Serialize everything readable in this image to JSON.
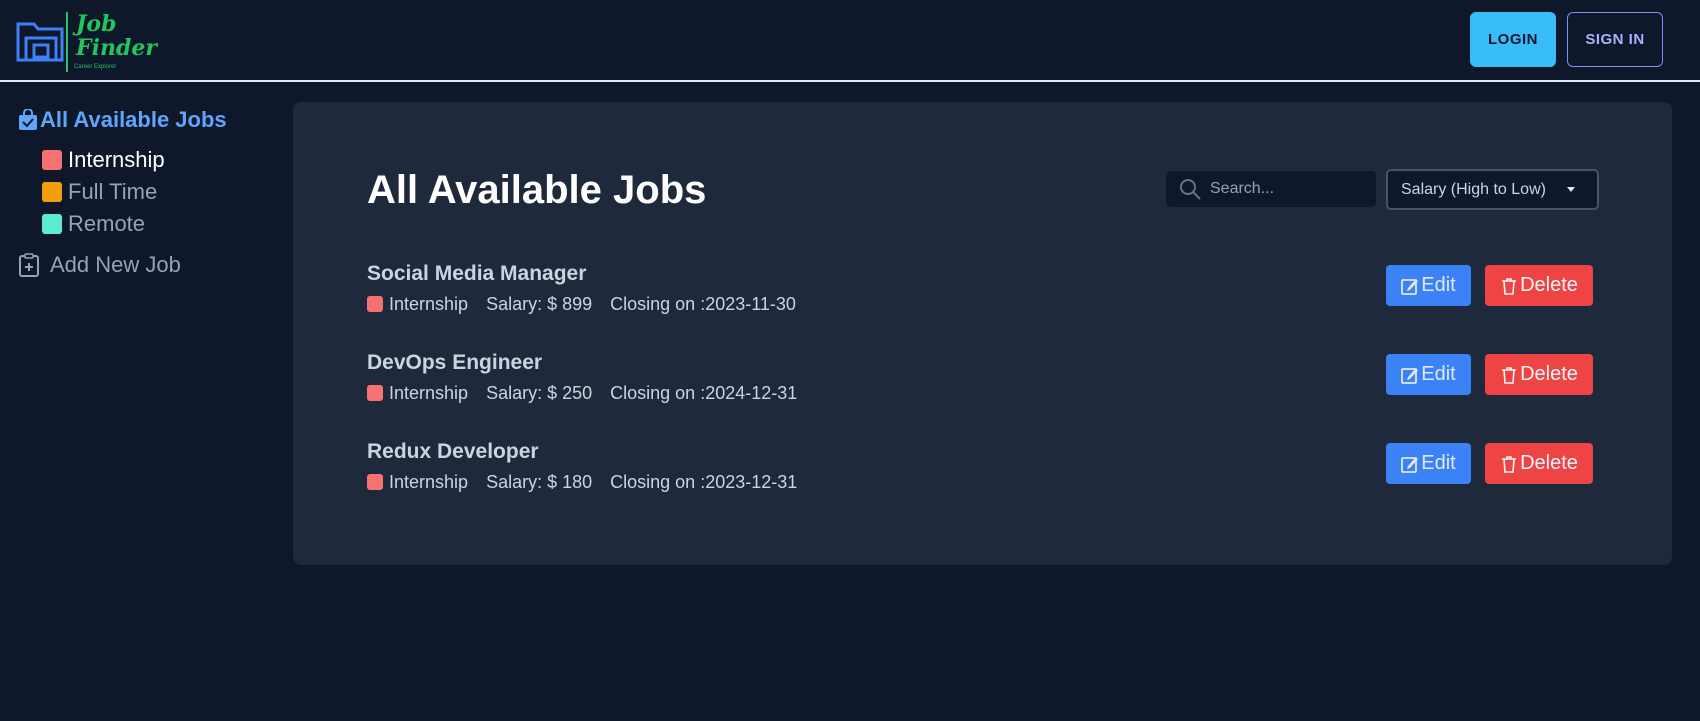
{
  "header": {
    "logo_text": "Job\nFinder",
    "logo_tagline": "Career Explorer",
    "login_label": "LOGIN",
    "signin_label": "SIGN IN"
  },
  "sidebar": {
    "all_jobs_label": "All Available Jobs",
    "filters": [
      {
        "label": "Internship",
        "color": "#f87171"
      },
      {
        "label": "Full Time",
        "color": "#f59e0b"
      },
      {
        "label": "Remote",
        "color": "#5eead4"
      }
    ],
    "add_job_label": "Add New Job"
  },
  "main": {
    "title": "All Available Jobs",
    "search_placeholder": "Search...",
    "sort_selected": "Salary (High to Low)",
    "jobs": [
      {
        "title": "Social Media Manager",
        "type": "Internship",
        "salary": "Salary: $ 899",
        "closing": "Closing on :2023-11-30"
      },
      {
        "title": "DevOps Engineer",
        "type": "Internship",
        "salary": "Salary: $ 250",
        "closing": "Closing on :2024-12-31"
      },
      {
        "title": "Redux Developer",
        "type": "Internship",
        "salary": "Salary: $ 180",
        "closing": "Closing on :2023-12-31"
      }
    ],
    "edit_label": "Edit",
    "delete_label": "Delete"
  },
  "colors": {
    "background": "#0f172a",
    "panel": "#1e293b",
    "accent_blue": "#3b82f6",
    "danger_red": "#ef4444",
    "brand_green": "#22c55e",
    "login_cyan": "#38bdf8"
  }
}
